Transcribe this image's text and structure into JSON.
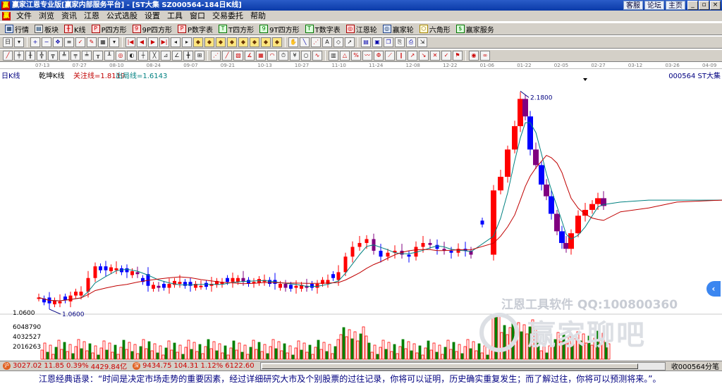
{
  "window": {
    "title": "赢家江恩专业版[赢家内部服务平台] - [ST大集  SZ000564-184日K线]",
    "links": [
      "客服",
      "论坛",
      "主页"
    ],
    "buttons": [
      "_",
      "▫",
      "×"
    ]
  },
  "menu": [
    "文件",
    "浏览",
    "资讯",
    "江恩",
    "公式选股",
    "设置",
    "工具",
    "窗口",
    "交易委托",
    "帮助"
  ],
  "toolbar1": [
    {
      "label": "行情",
      "icon": "quote-icon"
    },
    {
      "label": "板块",
      "icon": "sector-icon"
    },
    {
      "label": "K线",
      "icon": "kline-icon"
    },
    {
      "label": "P四方形",
      "icon": "p-square-icon"
    },
    {
      "label": "9P四方形",
      "icon": "9p-square-icon"
    },
    {
      "label": "P数字表",
      "icon": "p-number-table-icon"
    },
    {
      "label": "T四方形",
      "icon": "t-square-icon"
    },
    {
      "label": "9T四方形",
      "icon": "9t-square-icon"
    },
    {
      "label": "T数字表",
      "icon": "t-number-table-icon"
    },
    {
      "label": "江恩轮",
      "icon": "gann-wheel-icon"
    },
    {
      "label": "赢家轮",
      "icon": "winner-wheel-icon"
    },
    {
      "label": "六角形",
      "icon": "hexagon-icon"
    },
    {
      "label": "赢家服务",
      "icon": "winner-service-icon"
    }
  ],
  "dates": [
    "07-13",
    "07-27",
    "08-10",
    "08-24",
    "09-07",
    "09-21",
    "10-13",
    "10-27",
    "11-10",
    "11-24",
    "12-08",
    "12-22",
    "01-06",
    "01-22",
    "02-05",
    "02-27",
    "03-12",
    "03-26",
    "04-09"
  ],
  "chart": {
    "period": "日K线",
    "indicator": "乾坤K线",
    "focus_line": "关注线=1.8119",
    "exit_line": "出局线=1.6143",
    "stock": "000564  ST大集",
    "high_label": "2.1800",
    "low_label": "1.0600",
    "price_axis_low": "1.0600",
    "volume_ticks": [
      "6048790",
      "4032527",
      "2016263"
    ],
    "watermark_text": "江恩工具软件  QQ:100800360",
    "watermark_brand": "赢家聊吧",
    "colors": {
      "up": "#ff0000",
      "down": "#0000ff",
      "down2": "#800080",
      "ma_fast": "#008080",
      "ma_slow": "#c00000"
    }
  },
  "status": {
    "sh_index": "3027.02",
    "sh_change": "11.85",
    "sh_pct": "0.39%",
    "sh_amount": "4429.84亿",
    "sz_index": "9434.75",
    "sz_change": "104.31",
    "sz_pct": "1.12%",
    "sz_amount": "6122.60",
    "right_text": "收000564分笔"
  },
  "quote": "江恩经典语录：“时间是决定市场走势的重要因素，经过详细研究大市及个别股票的过往记录，你将可以证明，历史确实重复发生；而了解过往，你将可以预测将来。”。"
}
